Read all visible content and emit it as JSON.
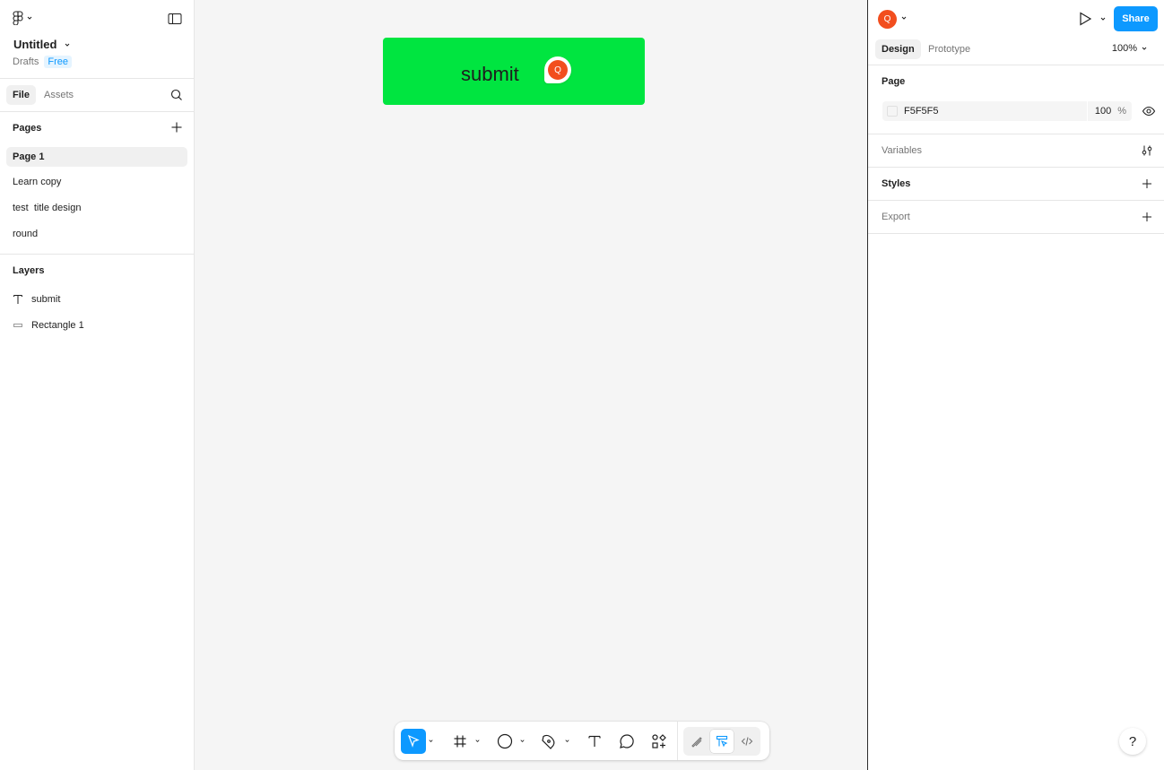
{
  "file": {
    "title": "Untitled",
    "location": "Drafts",
    "plan_badge": "Free"
  },
  "left_tabs": [
    {
      "label": "File",
      "active": true
    },
    {
      "label": "Assets",
      "active": false
    }
  ],
  "pages": {
    "header": "Pages",
    "items": [
      {
        "label": "Page 1",
        "active": true
      },
      {
        "label": "Learn copy",
        "active": false
      },
      {
        "label": "test  title design",
        "active": false
      },
      {
        "label": "round",
        "active": false
      }
    ]
  },
  "layers": {
    "header": "Layers",
    "items": [
      {
        "label": "submit",
        "icon": "text-icon"
      },
      {
        "label": "Rectangle 1",
        "icon": "rectangle-icon"
      }
    ]
  },
  "canvas": {
    "button_text": "submit",
    "button_color": "#00E540",
    "background": "#F5F5F5",
    "collaborator_initial": "Q"
  },
  "toolbar": {
    "tools": [
      "move-icon",
      "frame-icon",
      "ellipse-icon",
      "pen-icon",
      "text-icon",
      "comment-icon",
      "actions-icon"
    ],
    "modes": [
      "draw-mode-icon",
      "design-mode-icon",
      "dev-mode-icon"
    ],
    "active_tool": "move-icon",
    "active_mode": "design-mode-icon"
  },
  "right_panel": {
    "user_initial": "Q",
    "share_label": "Share",
    "tabs": [
      {
        "label": "Design",
        "active": true
      },
      {
        "label": "Prototype",
        "active": false
      }
    ],
    "zoom": "100%",
    "page_section": {
      "title": "Page",
      "bg_hex": "F5F5F5",
      "bg_opacity": "100",
      "opacity_unit": "%"
    },
    "variables_title": "Variables",
    "styles_title": "Styles",
    "export_title": "Export",
    "help_label": "?"
  },
  "colors": {
    "accent": "#0D99FF",
    "avatar": "#F24E1E"
  }
}
